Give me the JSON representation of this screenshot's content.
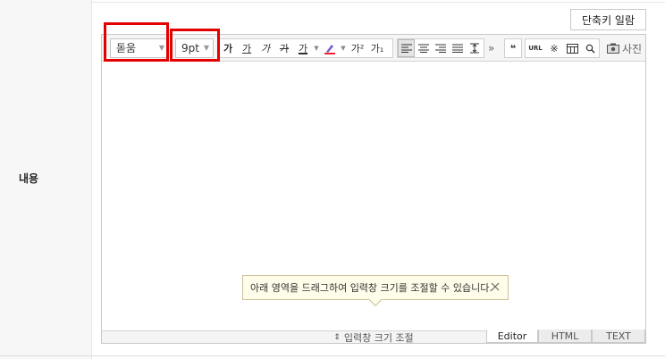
{
  "field": {
    "label": "내용"
  },
  "header": {
    "shortcut_label": "단축키 일람"
  },
  "toolbar": {
    "font_family": "돋움",
    "font_size": "9pt",
    "bold": "가",
    "underline": "가",
    "italic": "가",
    "strike": "가",
    "font_color": "가",
    "superscript": "가²",
    "subscript": "가₁",
    "more": "»",
    "quote": "❝",
    "url": "URL",
    "special_char": "※",
    "photo_label": "사진"
  },
  "tooltip": {
    "text": "아래 영역을 드래그하여 입력창 크기를 조절할 수 있습니다."
  },
  "resize": {
    "label": "입력창 크기 조절"
  },
  "modes": [
    "Editor",
    "HTML",
    "TEXT"
  ]
}
